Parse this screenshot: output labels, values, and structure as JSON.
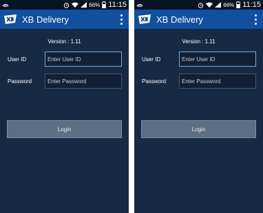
{
  "status_bar": {
    "battery": "66%",
    "time": "11:15"
  },
  "app": {
    "title": "XB Delivery"
  },
  "login_form": {
    "version": "Version : 1.11",
    "user_id_label": "User ID",
    "user_id_placeholder": "Enter User ID",
    "password_label": "Password",
    "password_placeholder": "Enter Password",
    "login_button": "Login"
  },
  "colors": {
    "app_bar": "#11509e",
    "background": "#162a44",
    "status_bar": "#071424",
    "button": "#5d6f84"
  },
  "icons": [
    "xb-logo-icon",
    "overflow-menu-icon",
    "wifi-icon",
    "signal-icon",
    "battery-icon",
    "alarm-icon",
    "cast-icon"
  ]
}
